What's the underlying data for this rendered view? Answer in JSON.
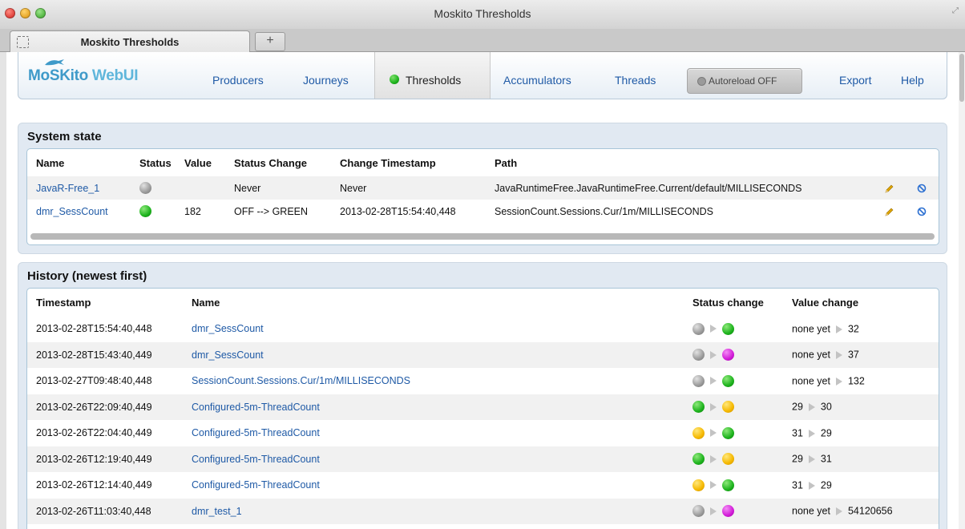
{
  "window": {
    "title": "Moskito Thresholds",
    "tab_title": "Moskito Thresholds",
    "new_tab": "+"
  },
  "logo": {
    "part1": "MoSKito",
    "part2": " WebUI"
  },
  "nav": {
    "producers": "Producers",
    "journeys": "Journeys",
    "thresholds": "Thresholds",
    "accumulators": "Accumulators",
    "threads": "Threads",
    "autoreload": "Autoreload OFF",
    "export": "Export",
    "help": "Help"
  },
  "system_state": {
    "title": "System state",
    "columns": [
      "Name",
      "Status",
      "Value",
      "Status Change",
      "Change Timestamp",
      "Path"
    ],
    "rows": [
      {
        "name": "JavaR-Free_1",
        "status": "grey",
        "value": "",
        "status_change": "Never",
        "timestamp": "Never",
        "path": "JavaRuntimeFree.JavaRuntimeFree.Current/default/MILLISECONDS"
      },
      {
        "name": "dmr_SessCount",
        "status": "green",
        "value": "182",
        "status_change": "OFF --> GREEN",
        "timestamp": "2013-02-28T15:54:40,448",
        "path": "SessionCount.Sessions.Cur/1m/MILLISECONDS"
      }
    ]
  },
  "history": {
    "title": "History (newest first)",
    "columns": [
      "Timestamp",
      "Name",
      "Status change",
      "Value change"
    ],
    "rows": [
      {
        "timestamp": "2013-02-28T15:54:40,448",
        "name": "dmr_SessCount",
        "from_status": "grey",
        "to_status": "green",
        "from_value": "none yet",
        "to_value": "32"
      },
      {
        "timestamp": "2013-02-28T15:43:40,449",
        "name": "dmr_SessCount",
        "from_status": "grey",
        "to_status": "purple",
        "from_value": "none yet",
        "to_value": "37"
      },
      {
        "timestamp": "2013-02-27T09:48:40,448",
        "name": "SessionCount.Sessions.Cur/1m/MILLISECONDS",
        "from_status": "grey",
        "to_status": "green",
        "from_value": "none yet",
        "to_value": "132"
      },
      {
        "timestamp": "2013-02-26T22:09:40,449",
        "name": "Configured-5m-ThreadCount",
        "from_status": "green",
        "to_status": "yellow",
        "from_value": "29",
        "to_value": "30"
      },
      {
        "timestamp": "2013-02-26T22:04:40,449",
        "name": "Configured-5m-ThreadCount",
        "from_status": "yellow",
        "to_status": "green",
        "from_value": "31",
        "to_value": "29"
      },
      {
        "timestamp": "2013-02-26T12:19:40,449",
        "name": "Configured-5m-ThreadCount",
        "from_status": "green",
        "to_status": "yellow",
        "from_value": "29",
        "to_value": "31"
      },
      {
        "timestamp": "2013-02-26T12:14:40,449",
        "name": "Configured-5m-ThreadCount",
        "from_status": "yellow",
        "to_status": "green",
        "from_value": "31",
        "to_value": "29"
      },
      {
        "timestamp": "2013-02-26T11:03:40,448",
        "name": "dmr_test_1",
        "from_status": "grey",
        "to_status": "purple",
        "from_value": "none yet",
        "to_value": "54120656"
      }
    ]
  },
  "colors": {
    "link": "#1f5aa6",
    "panel_bg": "#e1e9f2",
    "green": "#1db31d",
    "yellow": "#f5b800",
    "purple": "#d21bd8",
    "grey": "#9a9a9a"
  }
}
